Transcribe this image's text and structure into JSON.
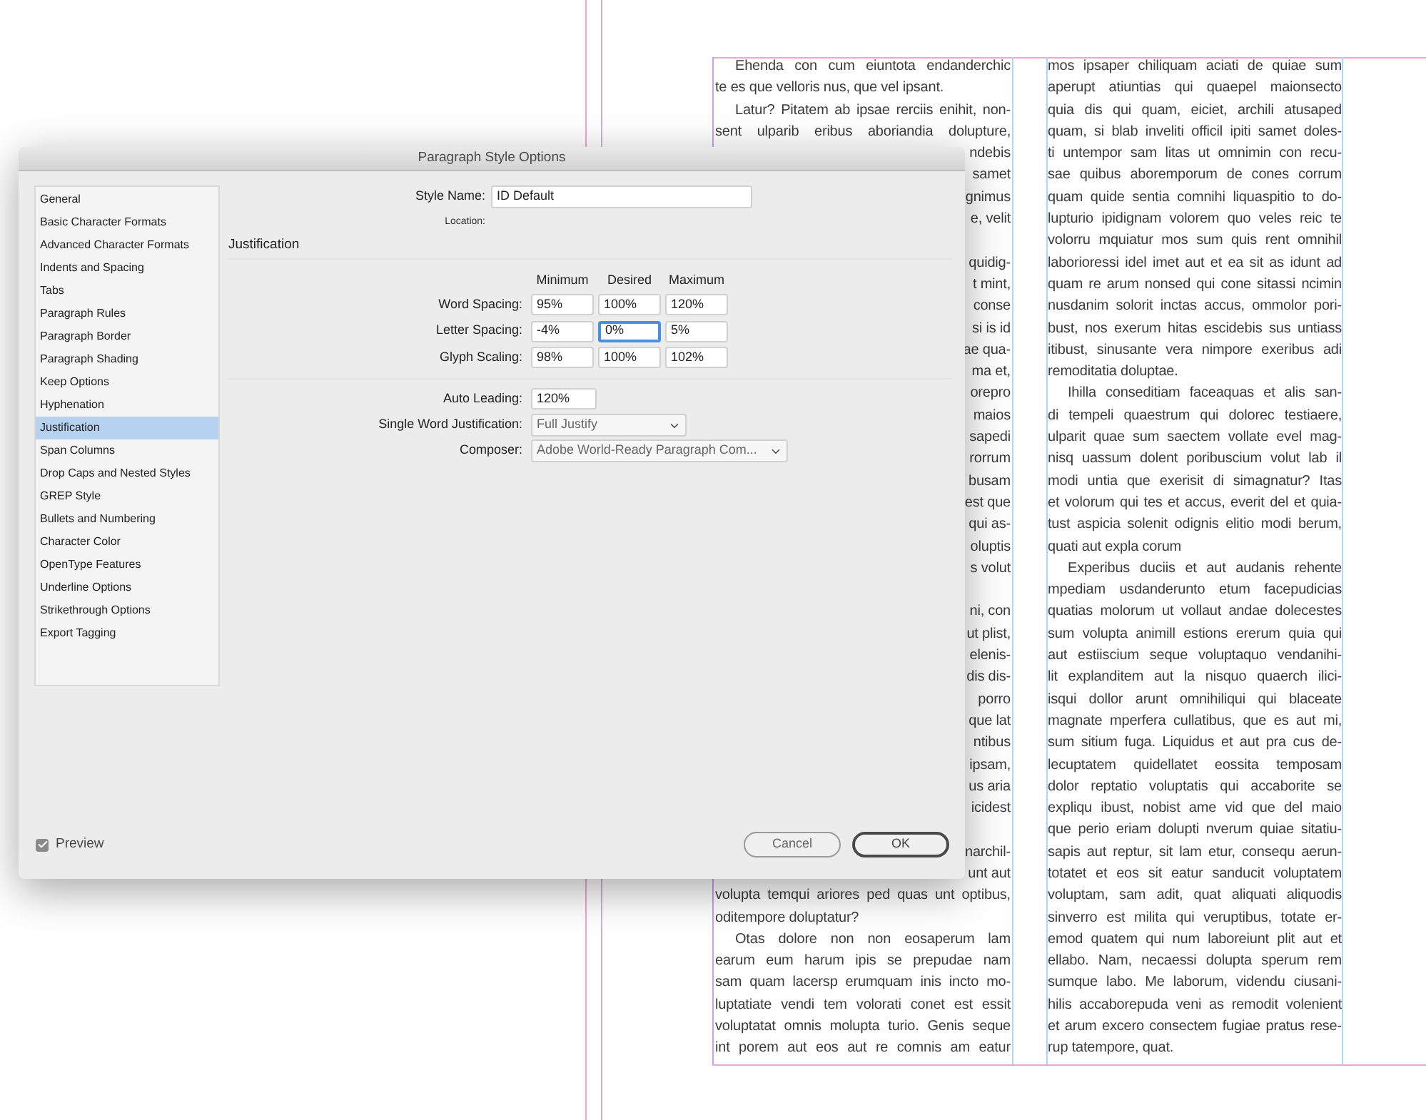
{
  "document": {
    "columns": [
      {
        "lines": [
          {
            "kind": "indent",
            "text": "Ehenda con cum eiuntota endanderchic"
          },
          {
            "kind": "last",
            "text": "te es que velloris nus, que vel ipsant."
          },
          {
            "kind": "indent",
            "text": "Latur? Pitatem ab ipsae rerciis enihit, non-"
          },
          {
            "kind": "justify",
            "text": "sent ulparib eribus aboriandia dolupture,"
          },
          {
            "kind": "fragment",
            "text": "ndebis"
          },
          {
            "kind": "fragment",
            "text": "samet"
          },
          {
            "kind": "fragment",
            "text": "gnimus"
          },
          {
            "kind": "fragment",
            "text": "e, velit"
          },
          {
            "kind": "hidden"
          },
          {
            "kind": "fragment",
            "text": "quidig-"
          },
          {
            "kind": "fragment",
            "text": "t mint,"
          },
          {
            "kind": "fragment",
            "text": "conse"
          },
          {
            "kind": "fragment",
            "text": "si is id"
          },
          {
            "kind": "fragment",
            "text": "ae qua-"
          },
          {
            "kind": "fragment",
            "text": "ma et,"
          },
          {
            "kind": "fragment",
            "text": "orepro"
          },
          {
            "kind": "fragment",
            "text": "maios"
          },
          {
            "kind": "fragment",
            "text": "sapedi"
          },
          {
            "kind": "fragment",
            "text": "rorrum"
          },
          {
            "kind": "fragment",
            "text": "busam"
          },
          {
            "kind": "fragment",
            "text": "est que"
          },
          {
            "kind": "fragment",
            "text": "qui as-"
          },
          {
            "kind": "fragment",
            "text": "oluptis"
          },
          {
            "kind": "fragment",
            "text": "s volut"
          },
          {
            "kind": "hidden"
          },
          {
            "kind": "fragment",
            "text": "ni, con"
          },
          {
            "kind": "fragment",
            "text": "ut plist,"
          },
          {
            "kind": "fragment",
            "text": "elenis-"
          },
          {
            "kind": "fragment",
            "text": "dis dis-"
          },
          {
            "kind": "fragment",
            "text": "porro"
          },
          {
            "kind": "fragment",
            "text": "que lat"
          },
          {
            "kind": "fragment",
            "text": "ntibus"
          },
          {
            "kind": "fragment",
            "text": "ipsam,"
          },
          {
            "kind": "fragment",
            "text": "us aria"
          },
          {
            "kind": "fragment",
            "text": "icidest"
          },
          {
            "kind": "hidden"
          },
          {
            "kind": "fragment",
            "text": "narchil-"
          },
          {
            "kind": "fragment",
            "text": "unt aut"
          },
          {
            "kind": "justify",
            "text": "volupta temqui ariores ped quas unt optibus,"
          },
          {
            "kind": "last",
            "text": "oditempore doluptatur?"
          },
          {
            "kind": "indent",
            "text": "Otas dolore non non eosaperum lam"
          },
          {
            "kind": "justify",
            "text": "earum eum harum ipis se prepudae nam"
          },
          {
            "kind": "justify",
            "text": "sam quam lacersp erumquam inis incto mo-"
          },
          {
            "kind": "justify",
            "text": "luptatiate vendi tem volorati conet est essit"
          },
          {
            "kind": "justify",
            "text": "voluptatat omnis molupta turio. Genis seque"
          },
          {
            "kind": "justify",
            "text": "int porem aut eos aut re comnis am eatur"
          }
        ]
      },
      {
        "lines": [
          {
            "kind": "justify",
            "text": "mos ipsaper chiliquam aciati de quiae sum"
          },
          {
            "kind": "justify",
            "text": "aperupt atiuntias qui quaepel maionsecto"
          },
          {
            "kind": "justify",
            "text": "quia dis qui quam, eiciet, archili atusaped"
          },
          {
            "kind": "justify",
            "text": "quam, si blab inveliti officil ipiti samet doles-"
          },
          {
            "kind": "justify",
            "text": "ti untempor sam litas ut omnimin con recu-"
          },
          {
            "kind": "justify",
            "text": "sae quibus aboremporum de cones corrum"
          },
          {
            "kind": "justify",
            "text": "quam quide sentia comnihi liquaspitio to do-"
          },
          {
            "kind": "justify",
            "text": "lupturio ipidignam volorem quo veles reic te"
          },
          {
            "kind": "justify",
            "text": "volorru mquiatur mos sum quis rent omnihil"
          },
          {
            "kind": "justify",
            "text": "laborioressi idel imet aut et ea sit as idunt ad"
          },
          {
            "kind": "justify",
            "text": "quam re arum nonsed qui cone sitassi ncimin"
          },
          {
            "kind": "justify",
            "text": "nusdanim solorit inctas accus, ommolor pori-"
          },
          {
            "kind": "justify",
            "text": "bust, nos exerum hitas escidebis sus untiass"
          },
          {
            "kind": "justify",
            "text": "itibust, sinusante vera nimpore exeribus adi"
          },
          {
            "kind": "last",
            "text": "remoditatia doluptae."
          },
          {
            "kind": "indent",
            "text": "Ihilla conseditiam faceaquas et alis san-"
          },
          {
            "kind": "justify",
            "text": "di tempeli quaestrum qui dolorec testiaere,"
          },
          {
            "kind": "justify",
            "text": "ulparit quae sum saectem vollate evel mag-"
          },
          {
            "kind": "justify",
            "text": "nisq uassum dolent poribuscium volut lab il"
          },
          {
            "kind": "justify",
            "text": "modi untia que exerisit di simagnatur? Itas"
          },
          {
            "kind": "justify",
            "text": "et volorum qui tes et accus, everit del et quia-"
          },
          {
            "kind": "justify",
            "text": "tust aspicia solenit odignis elitio modi berum,"
          },
          {
            "kind": "last",
            "text": "quati aut expla corum"
          },
          {
            "kind": "indent",
            "text": "Experibus duciis et aut audanis rehente"
          },
          {
            "kind": "justify",
            "text": "mpediam usdanderunto etum facepudicias"
          },
          {
            "kind": "justify",
            "text": "quatias molorum ut vollaut andae dolecestes"
          },
          {
            "kind": "justify",
            "text": "sum volupta animill estions ererum quia qui"
          },
          {
            "kind": "justify",
            "text": "aut estiiscium seque voluptaquo vendanihi-"
          },
          {
            "kind": "justify",
            "text": "lit explanditem aut la nisquo quaerch ilici-"
          },
          {
            "kind": "justify",
            "text": "isqui dollor arunt omnihiliqui qui blaceate"
          },
          {
            "kind": "justify",
            "text": "magnate mperfera cullatibus, que es aut mi,"
          },
          {
            "kind": "justify",
            "text": "sum sitium fuga. Liquidus et aut pra cus de-"
          },
          {
            "kind": "justify",
            "text": "lecuptatem quidellatet eossita temposam"
          },
          {
            "kind": "justify",
            "text": "dolor reptatio voluptatis qui accaborite se"
          },
          {
            "kind": "justify",
            "text": "expliqu ibust, nobist ame vid que del maio"
          },
          {
            "kind": "justify",
            "text": "que perio eriam dolupti nverum quiae sitatiu-"
          },
          {
            "kind": "justify",
            "text": "sapis aut reptur, sit lam etur, consequ aerun-"
          },
          {
            "kind": "justify",
            "text": "totatet et eos sit eatur sanducit voluptatem"
          },
          {
            "kind": "justify",
            "text": "voluptam, sam adit, quat aliquati aliquodis"
          },
          {
            "kind": "justify",
            "text": "sinverro est milita qui veruptibus, totate er-"
          },
          {
            "kind": "justify",
            "text": "emod quatem qui num laboreiunt plit aut et"
          },
          {
            "kind": "justify",
            "text": "ellabo. Nam, necaessi dolupta sperum rem"
          },
          {
            "kind": "justify",
            "text": "sumque labo. Me laborum, videndu ciusani-"
          },
          {
            "kind": "justify",
            "text": "hilis accaborepuda veni as remodit volenient"
          },
          {
            "kind": "justify",
            "text": "et arum excero consectem fugiae pratus rese-"
          },
          {
            "kind": "last",
            "text": "rup tatempore, quat."
          }
        ]
      }
    ]
  },
  "dialog": {
    "title": "Paragraph Style Options",
    "sidebar": [
      {
        "label": "General",
        "selected": false
      },
      {
        "label": "Basic Character Formats",
        "selected": false
      },
      {
        "label": "Advanced Character Formats",
        "selected": false
      },
      {
        "label": "Indents and Spacing",
        "selected": false
      },
      {
        "label": "Tabs",
        "selected": false
      },
      {
        "label": "Paragraph Rules",
        "selected": false
      },
      {
        "label": "Paragraph Border",
        "selected": false
      },
      {
        "label": "Paragraph Shading",
        "selected": false
      },
      {
        "label": "Keep Options",
        "selected": false
      },
      {
        "label": "Hyphenation",
        "selected": false
      },
      {
        "label": "Justification",
        "selected": true
      },
      {
        "label": "Span Columns",
        "selected": false
      },
      {
        "label": "Drop Caps and Nested Styles",
        "selected": false
      },
      {
        "label": "GREP Style",
        "selected": false
      },
      {
        "label": "Bullets and Numbering",
        "selected": false
      },
      {
        "label": "Character Color",
        "selected": false
      },
      {
        "label": "OpenType Features",
        "selected": false
      },
      {
        "label": "Underline Options",
        "selected": false
      },
      {
        "label": "Strikethrough Options",
        "selected": false
      },
      {
        "label": "Export Tagging",
        "selected": false
      }
    ],
    "style_name": {
      "label": "Style Name:",
      "value": "ID Default"
    },
    "location_label": "Location:",
    "section_title": "Justification",
    "grid": {
      "columns": [
        "Minimum",
        "Desired",
        "Maximum"
      ],
      "rows": [
        {
          "label": "Word Spacing:",
          "fields": [
            {
              "value": "95%",
              "focused": false
            },
            {
              "value": "100%",
              "focused": false
            },
            {
              "value": "120%",
              "focused": false
            }
          ]
        },
        {
          "label": "Letter Spacing:",
          "fields": [
            {
              "value": "-4%",
              "focused": false
            },
            {
              "value": "0%",
              "focused": true
            },
            {
              "value": "5%",
              "focused": false
            }
          ]
        },
        {
          "label": "Glyph Scaling:",
          "fields": [
            {
              "value": "98%",
              "focused": false
            },
            {
              "value": "100%",
              "focused": false
            },
            {
              "value": "102%",
              "focused": false
            }
          ]
        }
      ]
    },
    "auto_leading": {
      "label": "Auto Leading:",
      "value": "120%"
    },
    "single_word": {
      "label": "Single Word Justification:",
      "value": "Full Justify"
    },
    "composer": {
      "label": "Composer:",
      "value": "Adobe World-Ready Paragraph Com..."
    },
    "preview": {
      "label": "Preview",
      "checked": true
    },
    "buttons": [
      {
        "label": "Cancel",
        "kind": "secondary"
      },
      {
        "label": "OK",
        "kind": "default"
      }
    ]
  }
}
